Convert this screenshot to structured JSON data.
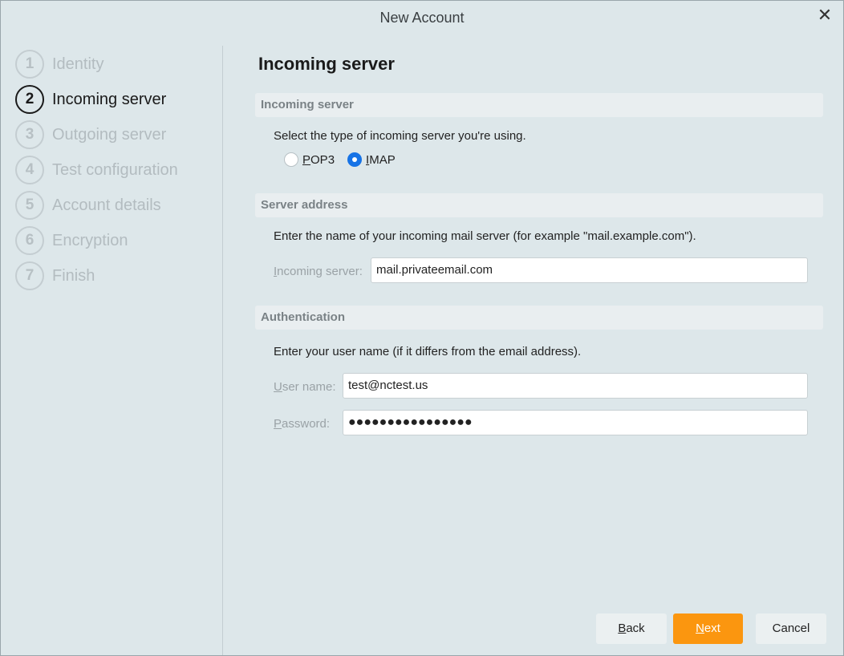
{
  "window": {
    "title": "New Account",
    "close_icon": "✕"
  },
  "steps": [
    {
      "num": "1",
      "label": "Identity",
      "active": false
    },
    {
      "num": "2",
      "label": "Incoming server",
      "active": true
    },
    {
      "num": "3",
      "label": "Outgoing server",
      "active": false
    },
    {
      "num": "4",
      "label": "Test configuration",
      "active": false
    },
    {
      "num": "5",
      "label": "Account details",
      "active": false
    },
    {
      "num": "6",
      "label": "Encryption",
      "active": false
    },
    {
      "num": "7",
      "label": "Finish",
      "active": false
    }
  ],
  "page": {
    "title": "Incoming server"
  },
  "incoming_section": {
    "header": "Incoming server",
    "description": "Select the type of incoming server you're using.",
    "options": [
      {
        "label_first": "P",
        "label_rest": "OP3",
        "checked": false
      },
      {
        "label_first": "I",
        "label_rest": "MAP",
        "checked": true
      }
    ]
  },
  "server_section": {
    "header": "Server address",
    "description": "Enter the name of your incoming mail server (for example \"mail.example.com\").",
    "label_first": "I",
    "label_rest": "ncoming server:",
    "value": "mail.privateemail.com"
  },
  "auth_section": {
    "header": "Authentication",
    "description": "Enter your user name (if it differs from the email address).",
    "username_label_first": "U",
    "username_label_rest": "ser name:",
    "username_value": "test@nctest.us",
    "password_label_first": "P",
    "password_label_rest": "assword:",
    "password_value": "●●●●●●●●●●●●●●●●"
  },
  "buttons": {
    "back_first": "B",
    "back_rest": "ack",
    "next_first": "N",
    "next_rest": "ext",
    "cancel": "Cancel"
  },
  "colors": {
    "accent": "#1673e6",
    "primary_button": "#fb960f",
    "background": "#dde7ea"
  }
}
